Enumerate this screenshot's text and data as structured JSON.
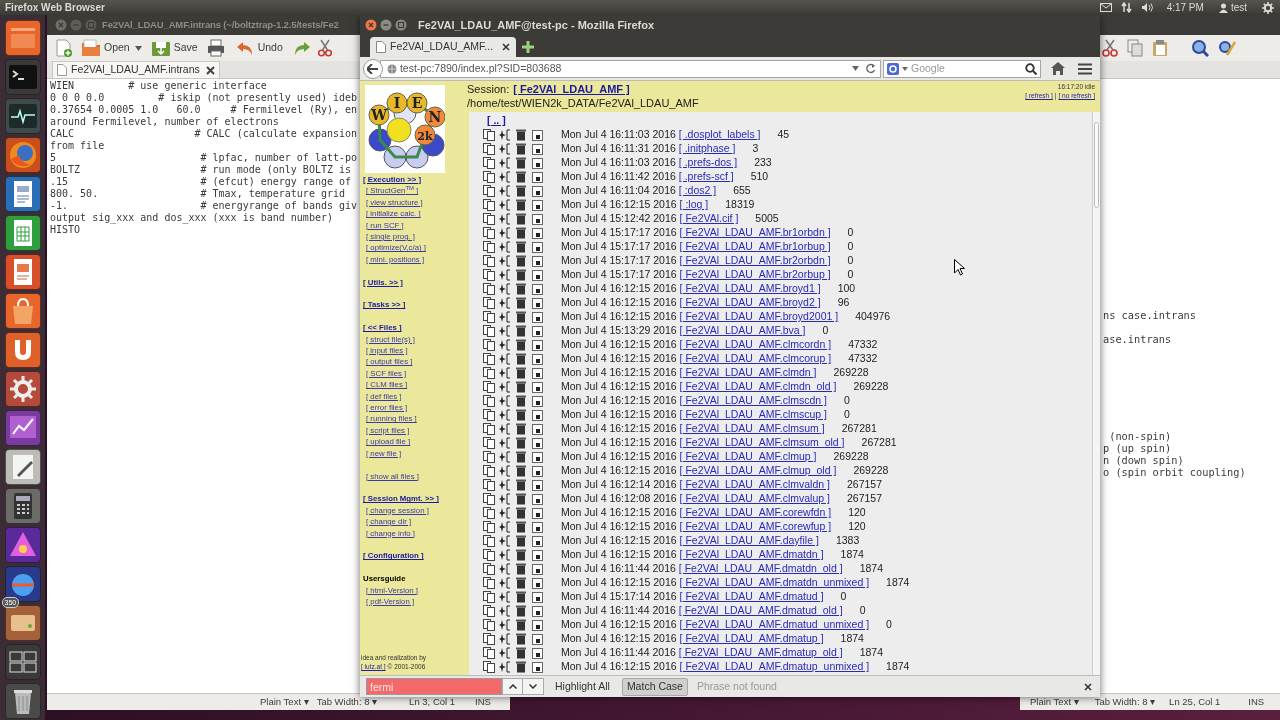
{
  "top_panel": {
    "app_title": "Firefox Web Browser",
    "clock": "4:17 PM",
    "user": "test"
  },
  "launcher": {
    "badge": "350"
  },
  "editor_front": {
    "title": "Fe2VAl_LDAU_AMF.intrans (~/boltztrap-1.2.5/tests/Fe2",
    "toolbar": [
      {
        "kind": "open",
        "label": "Open"
      },
      {
        "kind": "save",
        "label": "Save"
      },
      {
        "kind": "undo",
        "label": "Undo"
      }
    ],
    "tab": "Fe2VAl_LDAU_AMF.intrans",
    "lines": [
      "WIEN         # use generic interface",
      "0 0 0 0.0         # iskip (not presently used) ideb",
      "0.37654 0.0005 1.0   60.0     # Fermilevel (Ry), en",
      "around Fermilevel, number of electrons",
      "CALC                    # CALC (calculate expansion",
      "from file",
      "5                        # lpfac, number of latt-po",
      "BOLTZ                    # run mode (only BOLTZ is",
      ".15                      # (efcut) energy range of",
      "800. 50.                 # Tmax, temperature grid",
      "-1.                      # energyrange of bands giv",
      "output sig_xxx and dos_xxx (xxx is band number)",
      "HISTO"
    ],
    "status_bar": [
      "Plain Text ▾",
      "Tab Width: 8 ▾",
      "Ln 3, Col 1",
      "INS"
    ]
  },
  "editor_back": {
    "line_groups": [
      [
        "ns case.intrans"
      ],
      [
        "ase.intrans"
      ],
      [
        " (non-spin)",
        "p (up spin)",
        "n (down spin)",
        "o (spin orbit coupling)"
      ]
    ],
    "status_bar": [
      "Plain Text ▾",
      "Tab Width: 8 ▾",
      "Ln 25, Col 1",
      "INS"
    ]
  },
  "browser": {
    "title": "Fe2VAl_LDAU_AMF@test-pc - Mozilla Firefox",
    "tab": "Fe2VAl_LDAU_AMF...",
    "url": "test-pc:7890/index.pl?SID=803688",
    "search_placeholder": "Google",
    "logo_letters": [
      "W",
      "I",
      "E",
      "N",
      "2k"
    ],
    "sidebar": [
      {
        "kind": "menu",
        "heading": "[ Execution >> ]",
        "items": [
          "[ StructGen$^{TM}$ ]",
          "[ view structure ]",
          "[ initialize calc. ]",
          "[ run SCF ]",
          "[ single prog. ]",
          "[ optimize(V,c/a) ]",
          "[ mini. positions ]"
        ]
      },
      {
        "kind": "menu",
        "heading": "[ Utils. >> ]"
      },
      {
        "kind": "menu",
        "heading": "[ Tasks >> ]"
      },
      {
        "kind": "menu",
        "heading": "[ << Files ]",
        "items": [
          "[ struct file(s) ]",
          "[ input files ]",
          "[ output files ]",
          "[ SCF files ]",
          "[ CLM files ]",
          "[ def files ]",
          "[ error files ]",
          "[ running files ]",
          "[ script files ]",
          "[ upload file ]",
          "[ new file ]"
        ]
      },
      {
        "items": [
          "[ show all files ]"
        ]
      },
      {
        "kind": "menu",
        "heading": "[ Session Mgmt. >> ]",
        "items": [
          "[ change session ]",
          "[ change dir ]",
          "[ change info ]"
        ]
      },
      {
        "kind": "menu",
        "heading": "[ Configuration ]"
      },
      {
        "kind": "label",
        "heading": "Usersguide",
        "items": [
          "[ html-Version ]",
          "[ pdf-Version ]"
        ]
      }
    ],
    "footer": {
      "text": "idea and realization by",
      "link": "[ lutz.at ]",
      "copyright": "© 2001-2006"
    },
    "session_label": "Session:",
    "session_link": "[ Fe2VAl_LDAU_AMF ]",
    "path": "/home/test/WIEN2k_DATA/Fe2VAl_LDAU_AMF",
    "status": "16:17:20 idle",
    "refresh_links": [
      "[ refresh ]",
      "[ no refresh ]"
    ],
    "refresh_separator": "|",
    "parent_link": "[ .. ]",
    "files": [
      {
        "date": "Mon Jul 4 16:11:03 2016",
        "name": "[ .dosplot_labels ]",
        "size": "45"
      },
      {
        "date": "Mon Jul 4 16:11:31 2016",
        "name": "[ .initphase ]",
        "size": "3"
      },
      {
        "date": "Mon Jul 4 16:11:03 2016",
        "name": "[ .prefs-dos ]",
        "size": "233"
      },
      {
        "date": "Mon Jul 4 16:11:42 2016",
        "name": "[ .prefs-scf ]",
        "size": "510"
      },
      {
        "date": "Mon Jul 4 16:11:04 2016",
        "name": "[ :dos2 ]",
        "size": "655"
      },
      {
        "date": "Mon Jul 4 16:12:15 2016",
        "name": "[ :log ]",
        "size": "18319"
      },
      {
        "date": "Mon Jul 4 15:12:42 2016",
        "name": "[ Fe2VAl.cif ]",
        "size": "5005"
      },
      {
        "date": "Mon Jul 4 15:17:17 2016",
        "name": "[ Fe2VAl_LDAU_AMF.br1orbdn ]",
        "size": "0"
      },
      {
        "date": "Mon Jul 4 15:17:17 2016",
        "name": "[ Fe2VAl_LDAU_AMF.br1orbup ]",
        "size": "0"
      },
      {
        "date": "Mon Jul 4 15:17:17 2016",
        "name": "[ Fe2VAl_LDAU_AMF.br2orbdn ]",
        "size": "0"
      },
      {
        "date": "Mon Jul 4 15:17:17 2016",
        "name": "[ Fe2VAl_LDAU_AMF.br2orbup ]",
        "size": "0"
      },
      {
        "date": "Mon Jul 4 16:12:15 2016",
        "name": "[ Fe2VAl_LDAU_AMF.broyd1 ]",
        "size": "100"
      },
      {
        "date": "Mon Jul 4 16:12:15 2016",
        "name": "[ Fe2VAl_LDAU_AMF.broyd2 ]",
        "size": "96"
      },
      {
        "date": "Mon Jul 4 16:12:15 2016",
        "name": "[ Fe2VAl_LDAU_AMF.broyd2001 ]",
        "size": "404976"
      },
      {
        "date": "Mon Jul 4 15:13:29 2016",
        "name": "[ Fe2VAl_LDAU_AMF.bva ]",
        "size": "0"
      },
      {
        "date": "Mon Jul 4 16:12:15 2016",
        "name": "[ Fe2VAl_LDAU_AMF.clmcordn ]",
        "size": "47332"
      },
      {
        "date": "Mon Jul 4 16:12:15 2016",
        "name": "[ Fe2VAl_LDAU_AMF.clmcorup ]",
        "size": "47332"
      },
      {
        "date": "Mon Jul 4 16:12:15 2016",
        "name": "[ Fe2VAl_LDAU_AMF.clmdn ]",
        "size": "269228"
      },
      {
        "date": "Mon Jul 4 16:12:15 2016",
        "name": "[ Fe2VAl_LDAU_AMF.clmdn_old ]",
        "size": "269228"
      },
      {
        "date": "Mon Jul 4 16:12:15 2016",
        "name": "[ Fe2VAl_LDAU_AMF.clmscdn ]",
        "size": "0"
      },
      {
        "date": "Mon Jul 4 16:12:15 2016",
        "name": "[ Fe2VAl_LDAU_AMF.clmscup ]",
        "size": "0"
      },
      {
        "date": "Mon Jul 4 16:12:15 2016",
        "name": "[ Fe2VAl_LDAU_AMF.clmsum ]",
        "size": "267281"
      },
      {
        "date": "Mon Jul 4 16:12:15 2016",
        "name": "[ Fe2VAl_LDAU_AMF.clmsum_old ]",
        "size": "267281"
      },
      {
        "date": "Mon Jul 4 16:12:15 2016",
        "name": "[ Fe2VAl_LDAU_AMF.clmup ]",
        "size": "269228"
      },
      {
        "date": "Mon Jul 4 16:12:15 2016",
        "name": "[ Fe2VAl_LDAU_AMF.clmup_old ]",
        "size": "269228"
      },
      {
        "date": "Mon Jul 4 16:12:14 2016",
        "name": "[ Fe2VAl_LDAU_AMF.clmvaldn ]",
        "size": "267157"
      },
      {
        "date": "Mon Jul 4 16:12:08 2016",
        "name": "[ Fe2VAl_LDAU_AMF.clmvalup ]",
        "size": "267157"
      },
      {
        "date": "Mon Jul 4 16:12:15 2016",
        "name": "[ Fe2VAl_LDAU_AMF.corewfdn ]",
        "size": "120"
      },
      {
        "date": "Mon Jul 4 16:12:15 2016",
        "name": "[ Fe2VAl_LDAU_AMF.corewfup ]",
        "size": "120"
      },
      {
        "date": "Mon Jul 4 16:12:15 2016",
        "name": "[ Fe2VAl_LDAU_AMF.dayfile ]",
        "size": "1383"
      },
      {
        "date": "Mon Jul 4 16:12:15 2016",
        "name": "[ Fe2VAl_LDAU_AMF.dmatdn ]",
        "size": "1874"
      },
      {
        "date": "Mon Jul 4 16:11:44 2016",
        "name": "[ Fe2VAl_LDAU_AMF.dmatdn_old ]",
        "size": "1874"
      },
      {
        "date": "Mon Jul 4 16:12:15 2016",
        "name": "[ Fe2VAl_LDAU_AMF.dmatdn_unmixed ]",
        "size": "1874"
      },
      {
        "date": "Mon Jul 4 15:17:14 2016",
        "name": "[ Fe2VAl_LDAU_AMF.dmatud ]",
        "size": "0"
      },
      {
        "date": "Mon Jul 4 16:11:44 2016",
        "name": "[ Fe2VAl_LDAU_AMF.dmatud_old ]",
        "size": "0"
      },
      {
        "date": "Mon Jul 4 16:12:15 2016",
        "name": "[ Fe2VAl_LDAU_AMF.dmatud_unmixed ]",
        "size": "0"
      },
      {
        "date": "Mon Jul 4 16:12:15 2016",
        "name": "[ Fe2VAl_LDAU_AMF.dmatup ]",
        "size": "1874"
      },
      {
        "date": "Mon Jul 4 16:11:44 2016",
        "name": "[ Fe2VAl_LDAU_AMF.dmatup_old ]",
        "size": "1874"
      },
      {
        "date": "Mon Jul 4 16:12:15 2016",
        "name": "[ Fe2VAl_LDAU_AMF.dmatup_unmixed ]",
        "size": "1874"
      }
    ],
    "find_bar": {
      "value": "fermi",
      "found": false,
      "toggles": [
        {
          "label": "Highlight All",
          "selected": false
        },
        {
          "label": "Match Case",
          "selected": true
        }
      ],
      "message": "Phrase not found"
    }
  }
}
